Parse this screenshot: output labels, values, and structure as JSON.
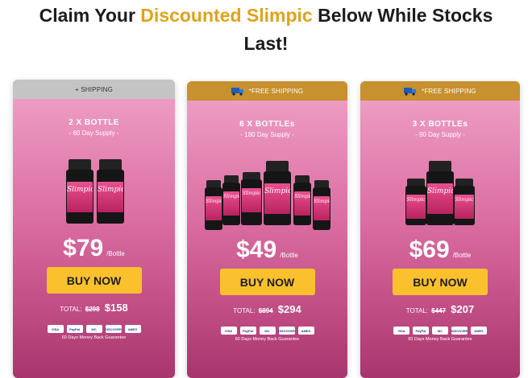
{
  "headline": {
    "part1": "Claim Your ",
    "highlight": "Discounted Slimpic",
    "part2": "  Below While Stocks",
    "line2": "Last!"
  },
  "colors": {
    "highlight": "#e0a21a",
    "button": "#fbc02d",
    "shipping_gold": "#c6912e",
    "shipping_gray": "#c4c4c4"
  },
  "packages": [
    {
      "shipping": "+ SHIPPING",
      "title": "2 X BOTTLE",
      "supply": "- 60 Day Supply -",
      "bottle_count": 2,
      "price": "$79",
      "per": "/Bottle",
      "cta": "BUY NOW",
      "total_label": "TOTAL:",
      "old_total": "$298",
      "new_total": "$158",
      "guarantee": "60 Days Money Back Guarantee"
    },
    {
      "shipping": "*FREE SHIPPING",
      "title": "6 X BOTTLEs",
      "supply": "- 180 Day Supply -",
      "bottle_count": 6,
      "price": "$49",
      "per": "/Bottle",
      "cta": "BUY NOW",
      "total_label": "TOTAL:",
      "old_total": "$894",
      "new_total": "$294",
      "guarantee": "60 Days Money Back Guarantee"
    },
    {
      "shipping": "*FREE SHIPPING",
      "title": "3 X BOTTLEs",
      "supply": "- 90 Day Supply -",
      "bottle_count": 3,
      "price": "$69",
      "per": "/Bottle",
      "cta": "BUY NOW",
      "total_label": "TOTAL:",
      "old_total": "$447",
      "new_total": "$207",
      "guarantee": "60 Days Money Back Guarantee"
    }
  ],
  "bottle_label": "Slimpic",
  "payment_icons": [
    "VISA",
    "PayPal",
    "MC",
    "DISCOVER",
    "AMEX"
  ]
}
